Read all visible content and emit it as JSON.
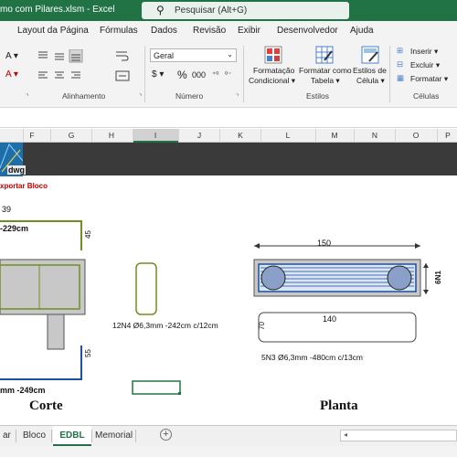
{
  "window": {
    "title": "mo com  Pilares.xlsm  -  Excel",
    "search_placeholder": "Pesquisar (Alt+G)"
  },
  "menu": {
    "items": [
      "Layout da Página",
      "Fórmulas",
      "Dados",
      "Revisão",
      "Exibir",
      "Desenvolvedor",
      "Ajuda"
    ]
  },
  "ribbon": {
    "number_format": "Geral",
    "percent_symbol": "%",
    "thousands_symbol": "000",
    "conditional_format": {
      "line1": "Formatação",
      "line2": "Condicional"
    },
    "format_table": {
      "line1": "Formatar como",
      "line2": "Tabela"
    },
    "cell_styles": {
      "line1": "Estilos de",
      "line2": "Célula"
    },
    "insert_label": "Inserir",
    "delete_label": "Excluir",
    "format_label": "Formatar",
    "groups": {
      "alignment": "Alinhamento",
      "number": "Número",
      "styles": "Estilos",
      "cells": "Células"
    }
  },
  "columns": [
    "F",
    "G",
    "H",
    "I",
    "J",
    "K",
    "L",
    "M",
    "N",
    "O",
    "P"
  ],
  "sheet": {
    "logo_text": "dwg",
    "export_link": "xportar Bloco",
    "dim_39": "39",
    "dim_229": "-229cm",
    "dim_45": "45",
    "dim_55": "55",
    "dim_249": "mm -249cm",
    "stirrup_label": "12N4 Ø6,3mm -242cm c/12cm",
    "dim_150": "150",
    "dim_6n1": "6N1",
    "dim_140": "140",
    "dim_70": "70",
    "bar_label": "5N3 Ø6,3mm -480cm c/13cm",
    "corte_title": "Corte",
    "planta_title": "Planta"
  },
  "tabs": {
    "items": [
      "ar",
      "Bloco",
      "EDBL",
      "Memorial"
    ],
    "active": "EDBL",
    "add_symbol": "+"
  }
}
